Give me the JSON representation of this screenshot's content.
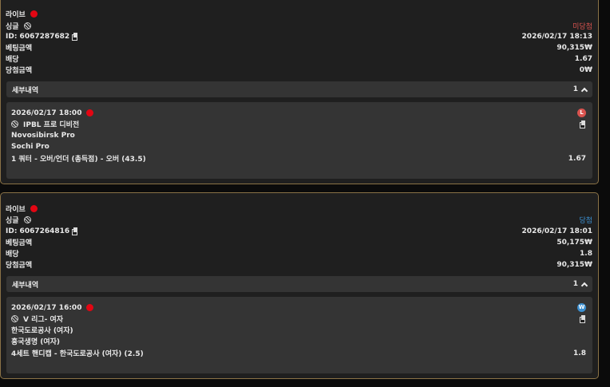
{
  "colors": {
    "lose": "#d9534f",
    "win": "#3b8fd0",
    "live_dot": "#e30613",
    "border": "#8a7246"
  },
  "bets": [
    {
      "type_label": "라이브",
      "bet_kind": "싱글",
      "status": "미당첨",
      "id_text": "ID: 6067287682",
      "datetime": "2026/02/17 18:13",
      "amount_label": "베팅금액",
      "amount": "90,315₩",
      "odds_label": "배당",
      "odds": "1.67",
      "payout_label": "당첨금액",
      "payout": "0₩",
      "detail_label": "세부내역",
      "detail_count": "1",
      "item": {
        "datetime": "2026/02/17 18:00",
        "league": "IPBL 프로 디비전",
        "team1": "Novosibirsk Pro",
        "team2": "Sochi Pro",
        "market": "1 쿼터 - 오버/언더 (총득점) - 오버 (43.5)",
        "odds": "1.67",
        "result": "L"
      }
    },
    {
      "type_label": "라이브",
      "bet_kind": "싱글",
      "status": "당첨",
      "id_text": "ID: 6067264816",
      "datetime": "2026/02/17 18:01",
      "amount_label": "베팅금액",
      "amount": "50,175₩",
      "odds_label": "배당",
      "odds": "1.8",
      "payout_label": "당첨금액",
      "payout": "90,315₩",
      "detail_label": "세부내역",
      "detail_count": "1",
      "item": {
        "datetime": "2026/02/17 16:00",
        "league": "V 리그- 여자",
        "team1": "한국도로공사 (여자)",
        "team2": "흥국생명 (여자)",
        "market": "4세트 핸디캡 - 한국도로공사 (여자) (2.5)",
        "odds": "1.8",
        "result": "W"
      }
    }
  ]
}
